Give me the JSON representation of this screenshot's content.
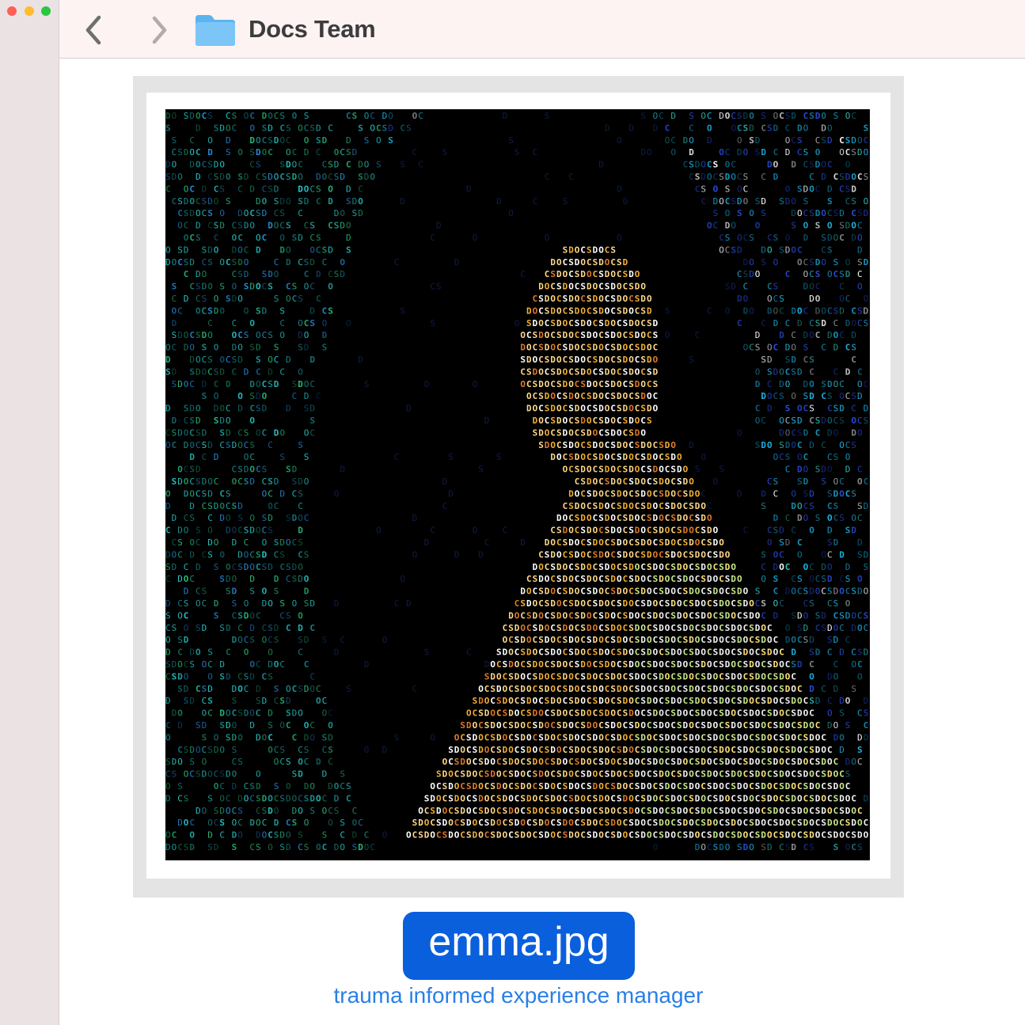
{
  "window": {
    "title": "Docs Team"
  },
  "toolbar": {
    "back_icon": "chevron-left-icon",
    "forward_icon": "chevron-right-icon",
    "folder_icon": "folder-icon"
  },
  "preview": {
    "filename": "emma.jpg",
    "caption": "trauma informed experience manager",
    "art_pattern_text": "DOCS",
    "art_background": "#000000",
    "art_colors": [
      "#1fb5d6",
      "#1fd0a0",
      "#2a4bd8",
      "#ffd27a",
      "#ffffff",
      "#f5a623"
    ]
  },
  "colors": {
    "accent": "#0a5fdd",
    "caption": "#2a7fe6",
    "toolbar_bg": "#fdf3f3",
    "sidebar_bg": "#ebe3e3",
    "frame": "#e4e4e4"
  }
}
